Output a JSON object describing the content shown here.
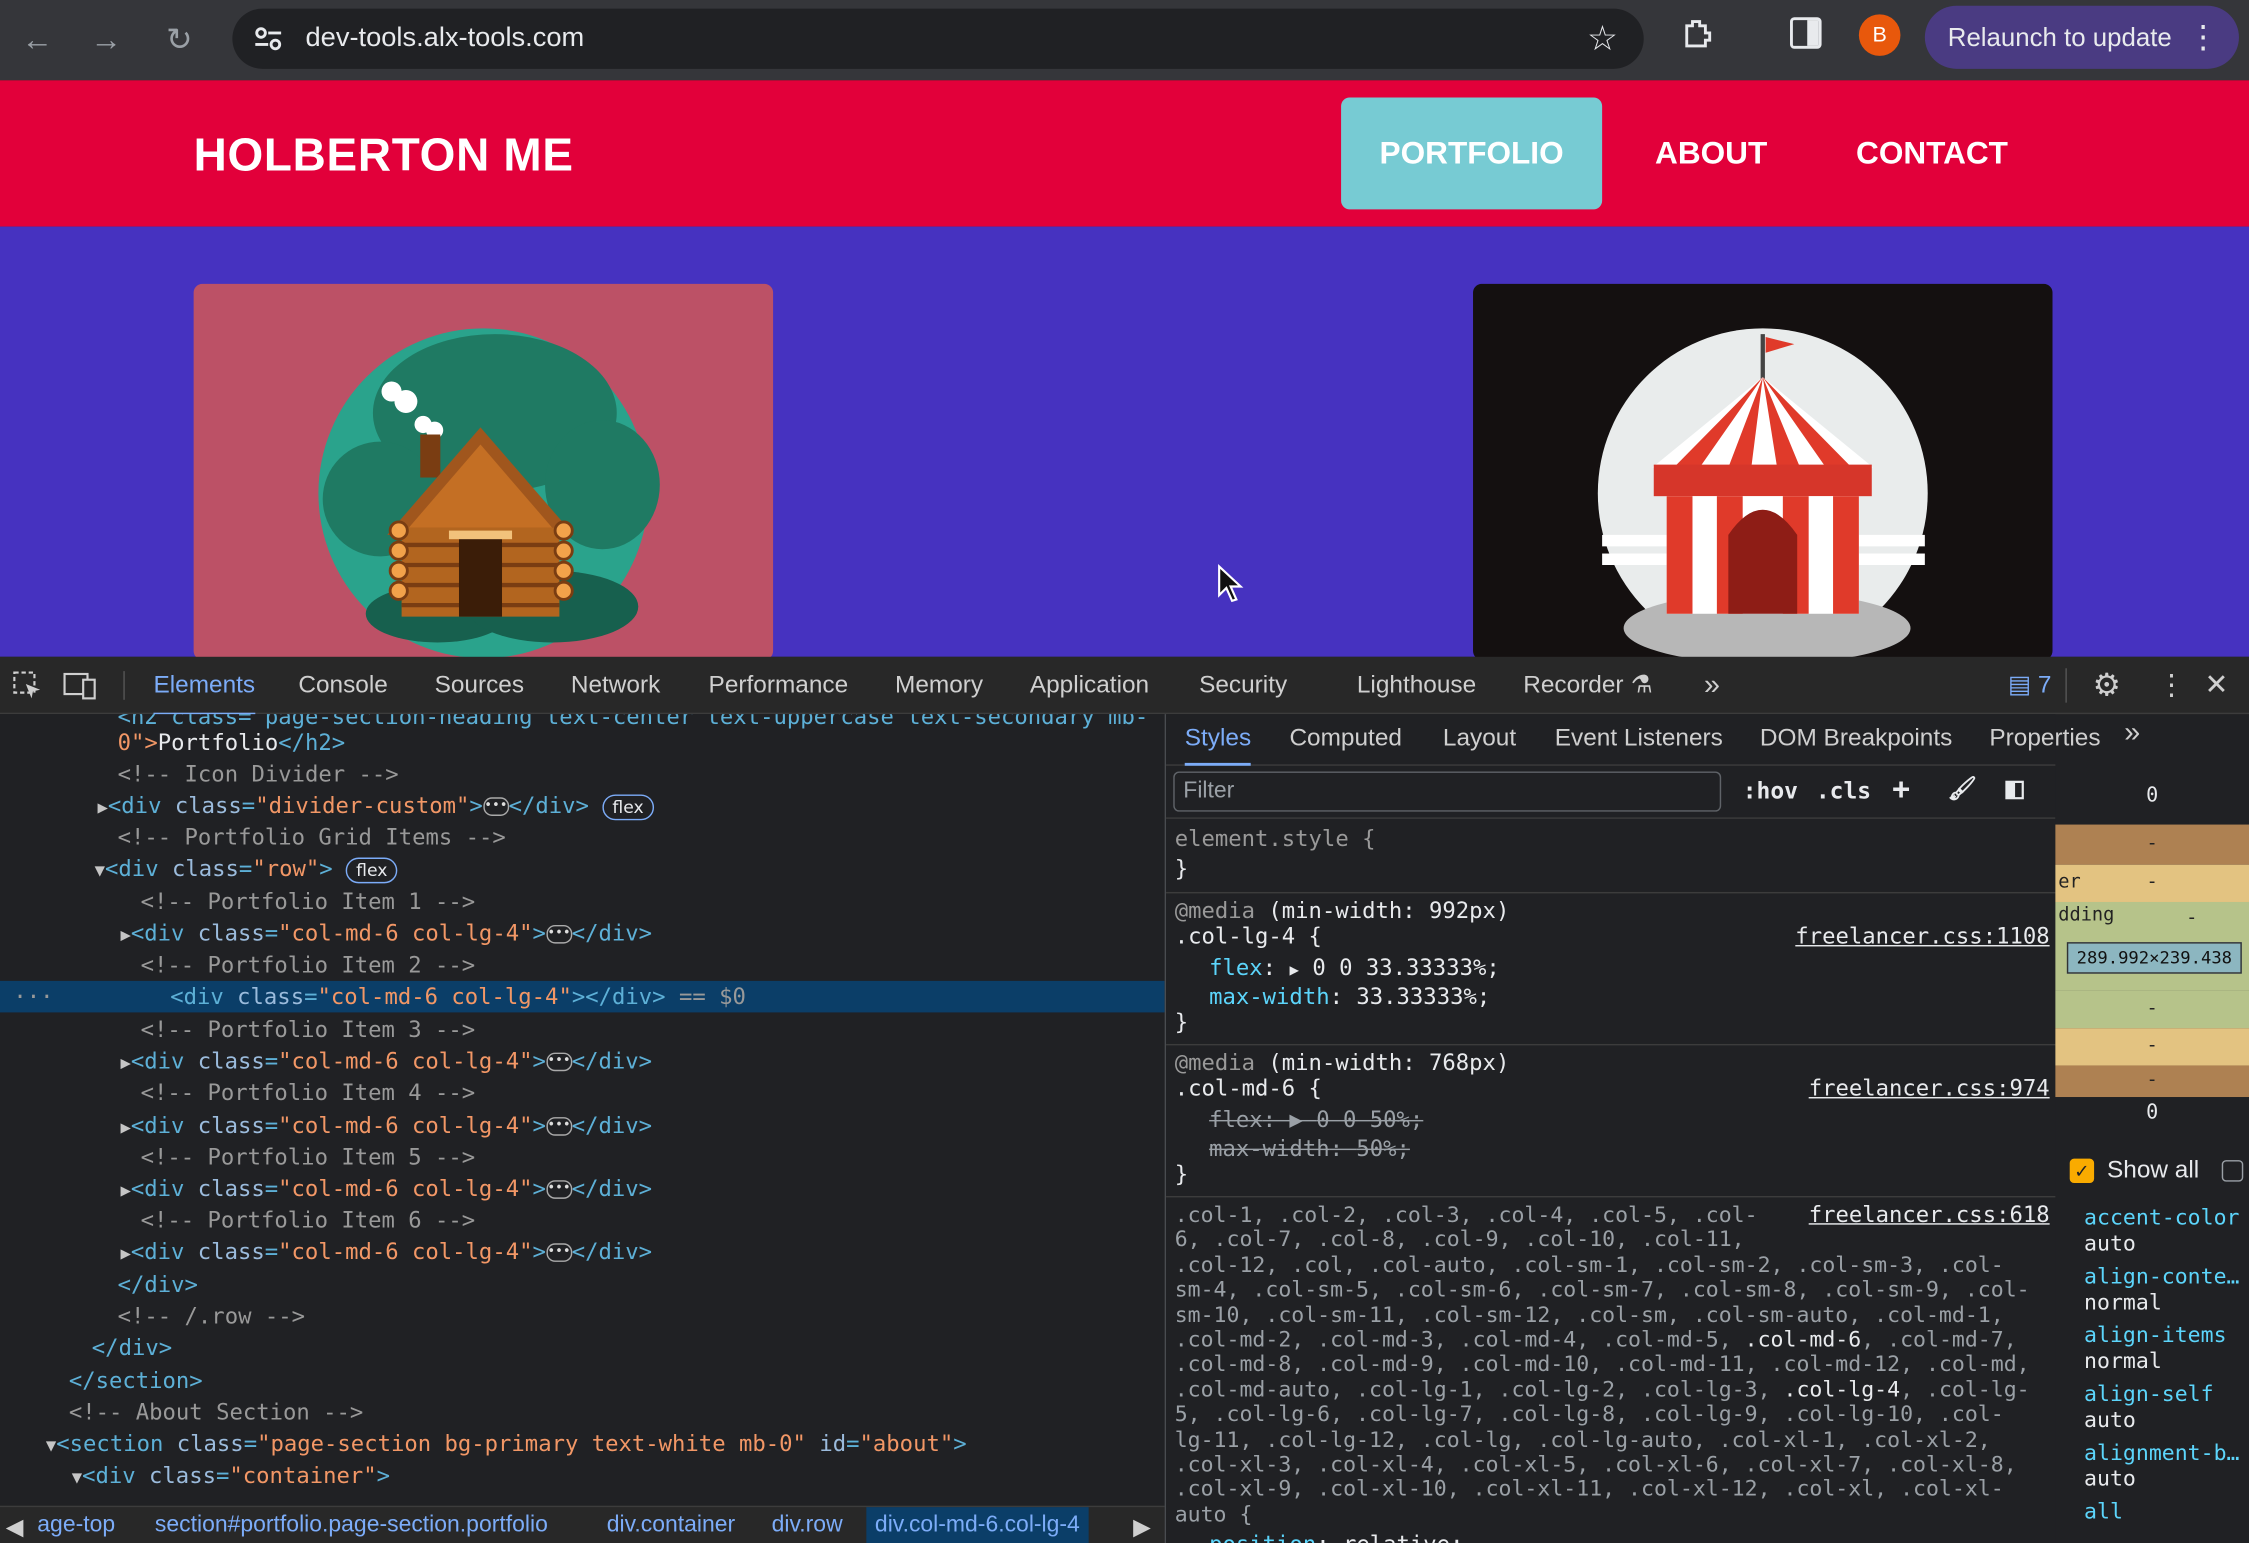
{
  "browser": {
    "url": "dev-tools.alx-tools.com",
    "avatar_letter": "B",
    "relaunch_label": "Relaunch to update"
  },
  "site": {
    "brand": "HOLBERTON ME",
    "nav": [
      "PORTFOLIO",
      "ABOUT",
      "CONTACT"
    ],
    "nav_active_color": "#77cbd3",
    "nav_bg": "#e2003a",
    "hero_bg": "#4632c0"
  },
  "devtools": {
    "tabs": [
      "Elements",
      "Console",
      "Sources",
      "Network",
      "Performance",
      "Memory",
      "Application",
      "Security",
      "Lighthouse",
      "Recorder"
    ],
    "issues_count": "7",
    "breadcrumbs": [
      "age-top",
      "section#portfolio.page-section.portfolio",
      "div.container",
      "div.row",
      "div.col-md-6.col-lg-4"
    ],
    "styles_tabs": [
      "Styles",
      "Computed",
      "Layout",
      "Event Listeners",
      "DOM Breakpoints",
      "Properties"
    ],
    "filter_placeholder": "Filter",
    "hov": ":hov",
    "cls": ".cls",
    "show_all": "Show all",
    "box_model": {
      "margin": "0",
      "content": "289.992×239.438",
      "bottom": "0",
      "dash": "-",
      "border_label": "er",
      "padding_label": "dding"
    },
    "computed": [
      {
        "name": "accent-color",
        "value": "auto"
      },
      {
        "name": "align-conte…",
        "value": "normal"
      },
      {
        "name": "align-items",
        "value": "normal"
      },
      {
        "name": "align-self",
        "value": "auto"
      },
      {
        "name": "alignment-b…",
        "value": "auto"
      },
      {
        "name": "all",
        "value": ""
      }
    ],
    "rules": {
      "element_style": "element.style {",
      "close": "}",
      "media1": "(min-width: 992px)",
      "sel1": ".col-lg-4 {",
      "src1": "freelancer.css:1108",
      "p1a": "flex",
      "v1a": "0 0 33.33333%;",
      "p1b": "max-width",
      "v1b": "33.33333%;",
      "media2": "(min-width: 768px)",
      "sel2": ".col-md-6 {",
      "src2": "freelancer.css:974",
      "p2a": "flex",
      "v2a": "0 0 50%;",
      "p2b": "max-width",
      "v2b": "50%;",
      "src3": "freelancer.css:618",
      "long_sel": [
        ".col-1, .col-2, .col-3, .col-4, .col-5, .col-",
        "6, .col-7, .col-8, .col-9, .col-10, .col-11,",
        ".col-12, .col, .col-auto, .col-sm-1, .col-sm-2, .col-sm-3, .col-",
        "sm-4, .col-sm-5, .col-sm-6, .col-sm-7, .col-sm-8, .col-sm-9, .col-",
        "sm-10, .col-sm-11, .col-sm-12, .col-sm, .col-sm-auto, .col-md-1,",
        ".col-md-2, .col-md-3, .col-md-4, .col-md-5, .col-md-6, .col-md-7,",
        ".col-md-8, .col-md-9, .col-md-10, .col-md-11, .col-md-12, .col-md,",
        ".col-md-auto, .col-lg-1, .col-lg-2, .col-lg-3, .col-lg-4, .col-lg-",
        "5, .col-lg-6, .col-lg-7, .col-lg-8, .col-lg-9, .col-lg-10, .col-",
        "lg-11, .col-lg-12, .col-lg, .col-lg-auto, .col-xl-1, .col-xl-2,",
        ".col-xl-3, .col-xl-4, .col-xl-5, .col-xl-6, .col-xl-7, .col-xl-8,",
        ".col-xl-9, .col-xl-10, .col-xl-11, .col-xl-12, .col-xl, .col-xl-",
        "auto {"
      ],
      "p3": "position",
      "v3": "relative;"
    },
    "dom": {
      "l0": "<h2 class=\"page-section-heading text-center text-uppercase text-secondary mb-",
      "l1a": "0\">",
      "l1b": "Portfolio",
      "l1c": "</h2>",
      "c_icon": "<!-- Icon Divider -->",
      "div_divider": "divider-custom",
      "c_grid": "<!-- Portfolio Grid Items -->",
      "row_class": "row",
      "col_class": "col-md-6 col-lg-4",
      "c_item1": "<!-- Portfolio Item 1 -->",
      "c_item2": "<!-- Portfolio Item 2 -->",
      "c_item3": "<!-- Portfolio Item 3 -->",
      "c_item4": "<!-- Portfolio Item 4 -->",
      "c_item5": "<!-- Portfolio Item 5 -->",
      "c_item6": "<!-- Portfolio Item 6 -->",
      "eq": "== $0",
      "div_close": "</div>",
      "c_row_end": "<!-- /.row -->",
      "section_close": "</section>",
      "c_about": "<!-- About Section -->",
      "about_class": "page-section bg-primary text-white mb-0",
      "about_id": "about",
      "container_class": "container",
      "flex_badge": "flex"
    }
  }
}
